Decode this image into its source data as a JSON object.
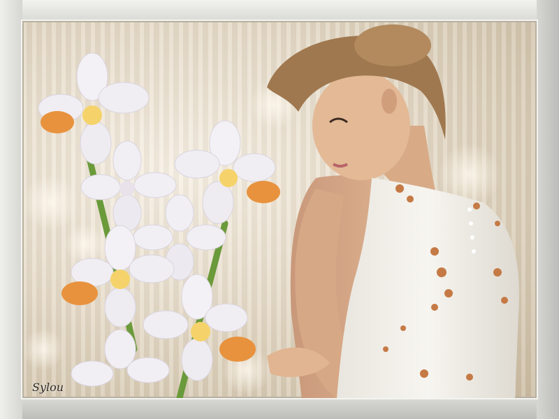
{
  "image": {
    "signature": "Sylou",
    "subject": {
      "palette": {
        "frame": "#d8d8d4",
        "background": "#e5dac7",
        "orchid_petal": "#f1eff4",
        "orchid_lip": "#e8923e",
        "stem": "#6a9a3a",
        "skin": "#d9ad8c",
        "hair": "#a0784f",
        "dress": "#f0ede6",
        "beads": "#c57a45"
      }
    }
  }
}
